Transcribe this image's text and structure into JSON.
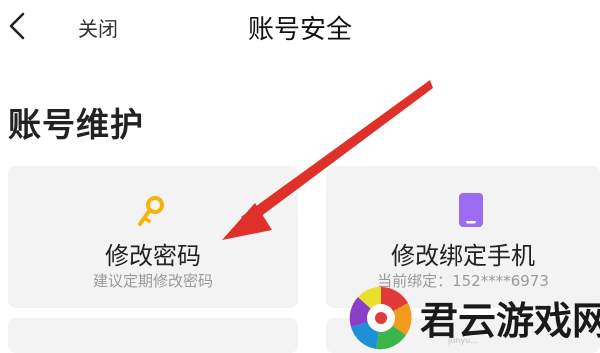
{
  "nav": {
    "close_label": "关闭",
    "title": "账号安全",
    "back_icon": "chevron-left-icon"
  },
  "section": {
    "title": "账号维护"
  },
  "cards": [
    {
      "label": "修改密码",
      "subtitle": "建议定期修改密码",
      "icon": "key-icon",
      "icon_color": "#f5b40a"
    },
    {
      "label": "修改绑定手机",
      "subtitle": "当前绑定：152****6973",
      "icon": "phone-icon",
      "icon_color": "#9b6bf2"
    }
  ],
  "overlay": {
    "arrow_color": "#e0302a"
  },
  "watermark": {
    "text": "君云游戏网",
    "small_text": "junyu..."
  }
}
